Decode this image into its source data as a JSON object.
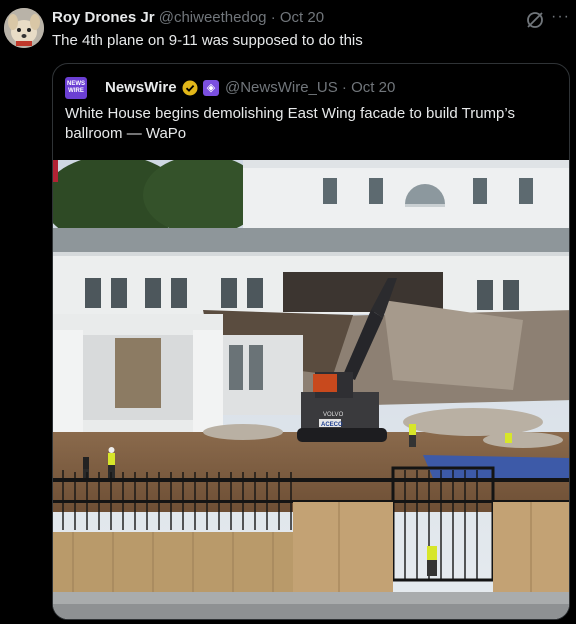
{
  "post": {
    "author_name": "Roy Drones Jr",
    "handle": "@chiweethedog",
    "separator": "·",
    "date": "Oct 20",
    "text": "The 4th plane on 9-11 was supposed to do this",
    "more_label": "···"
  },
  "quote": {
    "logo_text": "NEWS WIRE",
    "author_name": "NewsWire",
    "handle": "@NewsWire_US",
    "separator": "·",
    "date": "Oct 20",
    "text": "White House begins demolishing East Wing facade to build Trump’s ballroom — WaPo"
  },
  "photo": {
    "excavator_brand": "VOLVO",
    "excavator_sticker": "ACECO"
  },
  "colors": {
    "background": "#000000",
    "text": "#e7e9ea",
    "muted": "#71767b",
    "border": "#2f3336",
    "verified_gold": "#e2b719",
    "affiliate_purple": "#7b4fe0"
  }
}
